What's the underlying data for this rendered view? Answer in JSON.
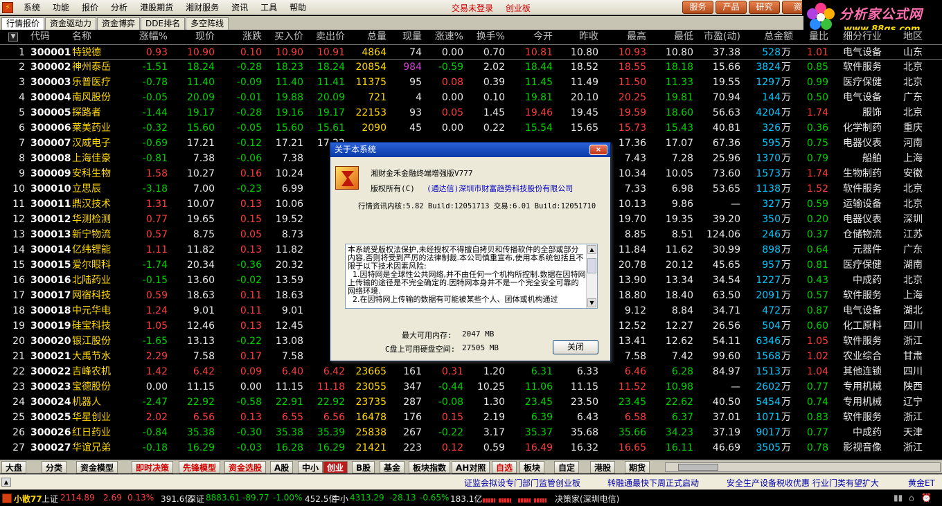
{
  "menu": {
    "items": [
      "系统",
      "功能",
      "报价",
      "分析",
      "港股期货",
      "湘财服务",
      "资讯",
      "工具",
      "帮助"
    ],
    "status": "交易未登录",
    "board": "创业板",
    "buttons": [
      "服务",
      "产品",
      "研究",
      "资"
    ]
  },
  "brand": {
    "name": "分析家公式网",
    "url": "www.88gs.com"
  },
  "tabs": [
    "行情报价",
    "资金驱动力",
    "资金博弈",
    "DDE排名",
    "多空阵线"
  ],
  "table": {
    "headers": [
      "代码",
      "名称",
      "涨幅%",
      "现价",
      "涨跌",
      "买入价",
      "卖出价",
      "总量",
      "现量",
      "涨速%",
      "换手%",
      "今开",
      "昨收",
      "最高",
      "最低",
      "市盈(动)",
      "总金额",
      "量比",
      "细分行业",
      "地区"
    ],
    "rows": [
      [
        "1",
        "300001",
        "特锐德",
        "0.93",
        "10.90",
        "0.10",
        "10.90",
        "10.91",
        "4864",
        "74",
        "0.00",
        "0.70",
        "10.81",
        "10.80",
        "10.93",
        "10.80",
        "37.38",
        "528",
        "1.01",
        "电气设备",
        "山东"
      ],
      [
        "2",
        "300002",
        "神州泰岳",
        "-1.51",
        "18.24",
        "-0.28",
        "18.23",
        "18.24",
        "20854",
        "984",
        "-0.59",
        "2.02",
        "18.44",
        "18.52",
        "18.55",
        "18.18",
        "15.66",
        "3824",
        "0.85",
        "软件服务",
        "北京"
      ],
      [
        "3",
        "300003",
        "乐普医疗",
        "-0.78",
        "11.40",
        "-0.09",
        "11.40",
        "11.41",
        "11375",
        "95",
        "0.08",
        "0.39",
        "11.45",
        "11.49",
        "11.50",
        "11.33",
        "19.55",
        "1297",
        "0.99",
        "医疗保健",
        "北京"
      ],
      [
        "4",
        "300004",
        "南风股份",
        "-0.05",
        "20.09",
        "-0.01",
        "19.88",
        "20.09",
        "721",
        "4",
        "0.00",
        "0.10",
        "19.81",
        "20.10",
        "20.25",
        "19.81",
        "70.94",
        "144",
        "0.50",
        "电气设备",
        "广东"
      ],
      [
        "5",
        "300005",
        "探路者",
        "-1.44",
        "19.17",
        "-0.28",
        "19.16",
        "19.17",
        "22153",
        "93",
        "0.05",
        "1.45",
        "19.46",
        "19.45",
        "19.59",
        "18.60",
        "56.63",
        "4204",
        "1.74",
        "服饰",
        "北京"
      ],
      [
        "6",
        "300006",
        "莱美药业",
        "-0.32",
        "15.60",
        "-0.05",
        "15.60",
        "15.61",
        "2090",
        "45",
        "0.00",
        "0.22",
        "15.54",
        "15.65",
        "15.73",
        "15.43",
        "40.81",
        "326",
        "0.36",
        "化学制药",
        "重庆"
      ],
      [
        "7",
        "300007",
        "汉威电子",
        "-0.69",
        "17.21",
        "-0.12",
        "17.21",
        "17.22",
        "",
        "",
        "",
        "",
        "",
        "",
        "17.36",
        "17.07",
        "67.36",
        "595",
        "0.75",
        "电器仪表",
        "河南"
      ],
      [
        "8",
        "300008",
        "上海佳豪",
        "-0.81",
        "7.38",
        "-0.06",
        "7.38",
        "7",
        "",
        "",
        "",
        "",
        "",
        "",
        "7.43",
        "7.28",
        "25.96",
        "1370",
        "0.79",
        "船舶",
        "上海"
      ],
      [
        "9",
        "300009",
        "安科生物",
        "1.58",
        "10.27",
        "0.16",
        "10.24",
        "1",
        "",
        "",
        "",
        "",
        "",
        "",
        "10.34",
        "10.05",
        "73.60",
        "1573",
        "1.74",
        "生物制药",
        "安徽"
      ],
      [
        "10",
        "300010",
        "立思辰",
        "-3.18",
        "7.00",
        "-0.23",
        "6.99",
        "7",
        "",
        "",
        "",
        "",
        "",
        "",
        "7.33",
        "6.98",
        "53.65",
        "1138",
        "1.52",
        "软件服务",
        "北京"
      ],
      [
        "11",
        "300011",
        "鼎汉技术",
        "1.31",
        "10.07",
        "0.13",
        "10.06",
        "1",
        "",
        "",
        "",
        "",
        "",
        "",
        "10.13",
        "9.86",
        "—",
        "327",
        "0.59",
        "运输设备",
        "北京"
      ],
      [
        "12",
        "300012",
        "华测检测",
        "0.77",
        "19.65",
        "0.15",
        "19.52",
        "1",
        "",
        "",
        "",
        "",
        "",
        "",
        "19.70",
        "19.35",
        "39.20",
        "350",
        "0.20",
        "电器仪表",
        "深圳"
      ],
      [
        "13",
        "300013",
        "新宁物流",
        "0.57",
        "8.75",
        "0.05",
        "8.73",
        "8",
        "",
        "",
        "",
        "",
        "",
        "",
        "8.85",
        "8.51",
        "124.06",
        "246",
        "0.37",
        "仓储物流",
        "江苏"
      ],
      [
        "14",
        "300014",
        "亿纬锂能",
        "1.11",
        "11.82",
        "0.13",
        "11.82",
        "1",
        "",
        "",
        "",
        "",
        "",
        "",
        "11.84",
        "11.62",
        "30.99",
        "898",
        "0.64",
        "元器件",
        "广东"
      ],
      [
        "15",
        "300015",
        "爱尔眼科",
        "-1.74",
        "20.34",
        "-0.36",
        "20.32",
        "2",
        "",
        "",
        "",
        "",
        "",
        "",
        "20.78",
        "20.12",
        "45.65",
        "957",
        "0.81",
        "医疗保健",
        "湖南"
      ],
      [
        "16",
        "300016",
        "北陆药业",
        "-0.15",
        "13.60",
        "-0.02",
        "13.59",
        "1",
        "",
        "",
        "",
        "",
        "",
        "",
        "13.90",
        "13.34",
        "34.54",
        "1227",
        "0.43",
        "中成药",
        "北京"
      ],
      [
        "17",
        "300017",
        "网宿科技",
        "0.59",
        "18.63",
        "0.11",
        "18.63",
        "1",
        "",
        "",
        "",
        "",
        "",
        "",
        "18.80",
        "18.40",
        "63.50",
        "2091",
        "0.57",
        "软件服务",
        "上海"
      ],
      [
        "18",
        "300018",
        "中元华电",
        "1.24",
        "9.01",
        "0.11",
        "9.01",
        "9",
        "",
        "",
        "",
        "",
        "",
        "",
        "9.12",
        "8.84",
        "34.71",
        "472",
        "0.87",
        "电气设备",
        "湖北"
      ],
      [
        "19",
        "300019",
        "硅宝科技",
        "1.05",
        "12.46",
        "0.13",
        "12.45",
        "1",
        "",
        "",
        "",
        "",
        "",
        "",
        "12.52",
        "12.27",
        "26.56",
        "504",
        "0.60",
        "化工原料",
        "四川"
      ],
      [
        "20",
        "300020",
        "银江股份",
        "-1.65",
        "13.13",
        "-0.22",
        "13.08",
        "1",
        "",
        "",
        "",
        "",
        "",
        "",
        "13.41",
        "12.62",
        "54.11",
        "6346",
        "1.05",
        "软件服务",
        "浙江"
      ],
      [
        "21",
        "300021",
        "大禹节水",
        "2.29",
        "7.58",
        "0.17",
        "7.58",
        "7",
        "",
        "",
        "",
        "",
        "",
        "",
        "7.58",
        "7.42",
        "99.60",
        "1568",
        "1.02",
        "农业综合",
        "甘肃"
      ],
      [
        "22",
        "300022",
        "吉峰农机",
        "1.42",
        "6.42",
        "0.09",
        "6.40",
        "6.42",
        "23665",
        "161",
        "0.31",
        "1.20",
        "6.31",
        "6.33",
        "6.46",
        "6.28",
        "84.97",
        "1513",
        "1.04",
        "其他连锁",
        "四川"
      ],
      [
        "23",
        "300023",
        "宝德股份",
        "0.00",
        "11.15",
        "0.00",
        "11.15",
        "11.18",
        "23055",
        "347",
        "-0.44",
        "10.25",
        "11.06",
        "11.15",
        "11.52",
        "10.98",
        "—",
        "2602",
        "0.77",
        "专用机械",
        "陕西"
      ],
      [
        "24",
        "300024",
        "机器人",
        "-2.47",
        "22.92",
        "-0.58",
        "22.91",
        "22.92",
        "23735",
        "287",
        "-0.08",
        "1.30",
        "23.45",
        "23.50",
        "23.45",
        "22.62",
        "40.50",
        "5454",
        "0.74",
        "专用机械",
        "辽宁"
      ],
      [
        "25",
        "300025",
        "华星创业",
        "2.02",
        "6.56",
        "0.13",
        "6.55",
        "6.56",
        "16478",
        "176",
        "0.15",
        "2.19",
        "6.39",
        "6.43",
        "6.58",
        "6.37",
        "37.01",
        "1071",
        "0.83",
        "软件服务",
        "浙江"
      ],
      [
        "26",
        "300026",
        "红日药业",
        "-0.84",
        "35.38",
        "-0.30",
        "35.38",
        "35.39",
        "25838",
        "267",
        "-0.22",
        "3.17",
        "35.37",
        "35.68",
        "35.66",
        "34.23",
        "37.19",
        "9017",
        "0.77",
        "中成药",
        "天津"
      ],
      [
        "27",
        "300027",
        "华谊兄弟",
        "-0.18",
        "16.29",
        "-0.03",
        "16.28",
        "16.29",
        "21421",
        "223",
        "0.12",
        "0.59",
        "16.49",
        "16.32",
        "16.65",
        "16.11",
        "46.69",
        "3505",
        "0.78",
        "影视音像",
        "浙江"
      ]
    ],
    "wan": "万"
  },
  "categories": [
    "大盘",
    "分类",
    "资金模型",
    "即时决策",
    "先锋模型",
    "资金选股",
    "A股",
    "中小",
    "创业",
    "B股",
    "基金",
    "板块指数",
    "AH对照",
    "自选",
    "板块",
    "自定",
    "港股",
    "期货"
  ],
  "news": [
    "证监会拟设专门部门监管创业板",
    "转融通最快下周正式启动",
    "安全生产设备税收优惠  行业门类有望扩大",
    "黄金ET"
  ],
  "statusbar": {
    "label": "小散77",
    "sh_name": "上证",
    "sh_value": "2114.89",
    "sh_change": "2.69",
    "sh_pct": "0.13%",
    "sh_amount": "391.6亿",
    "sz_name": "深证",
    "sz_value": "8883.61",
    "sz_change": "-89.77",
    "sz_pct": "-1.00%",
    "sz_amount": "452.5亿",
    "zx_name": "中小",
    "zx_value": "4313.29",
    "zx_change": "-28.13",
    "zx_pct": "-0.65%",
    "zx_amount": "183.1亿",
    "broker": "决策家(深圳电信)"
  },
  "dialog": {
    "title": "关于本系统",
    "close": "×",
    "product": "湘财金禾金融终端增强版V777",
    "copyright_label": "版权所有(C)",
    "copyright_owner": "(通达信)深圳市财富趋势科技股份有限公司",
    "version": "行情资讯内核:5.82 Build:12051713 交易:6.01 Build:12051710",
    "license": "本系统受版权法保护,未经授权不得擅自拷贝和传播软件的全部或部分内容,否则将受到严厉的法律制裁.本公司慎重宣布,使用本系统包括且不限于以下技术因素风险:\n  1.因特网是全球性公共网络,并不由任何一个机构所控制.数据在因特网上传输的途径是不完全确定的.因特网本身并不是一个完全安全可靠的网络环境.\n  2.在因特网上传输的数据有可能被某些个人、团体或机构通过",
    "mem_label": "最大可用内存:",
    "mem_value": "2047 MB",
    "disk_label": "C盘上可用硬盘空间:",
    "disk_value": "27505 MB",
    "button": "关闭"
  }
}
